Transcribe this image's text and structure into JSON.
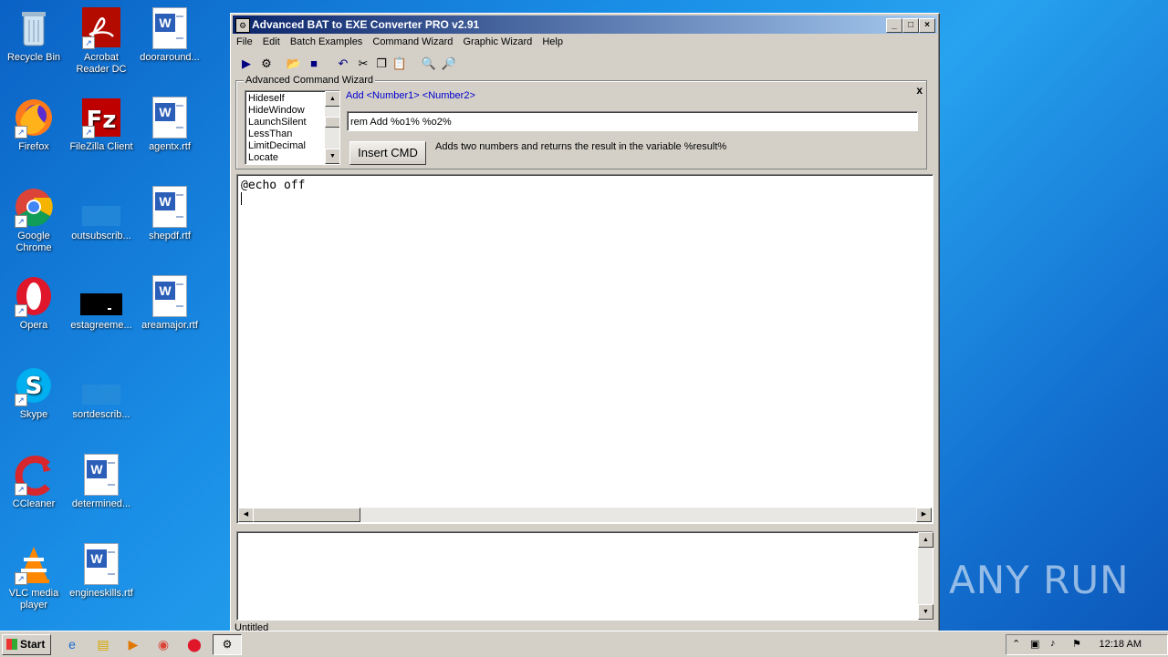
{
  "desktop": {
    "icons": [
      {
        "label": "Recycle Bin"
      },
      {
        "label": "Acrobat Reader DC"
      },
      {
        "label": "dooraround..."
      },
      {
        "label": "Firefox"
      },
      {
        "label": "FileZilla Client"
      },
      {
        "label": "agentx.rtf"
      },
      {
        "label": "Google Chrome"
      },
      {
        "label": "outsubscrib..."
      },
      {
        "label": "shepdf.rtf"
      },
      {
        "label": "Opera"
      },
      {
        "label": "estagreeme..."
      },
      {
        "label": "areamajor.rtf"
      },
      {
        "label": "Skype"
      },
      {
        "label": "sortdescrib..."
      },
      {
        "label": "CCleaner"
      },
      {
        "label": "determined..."
      },
      {
        "label": "VLC media player"
      },
      {
        "label": "engineskills.rtf"
      }
    ],
    "watermark": "ANY RUN"
  },
  "window": {
    "title": "Advanced BAT to EXE Converter PRO v2.91",
    "menu": [
      "File",
      "Edit",
      "Batch Examples",
      "Command Wizard",
      "Graphic Wizard",
      "Help"
    ],
    "wizard": {
      "legend": "Advanced Command Wizard",
      "close": "x",
      "commands": [
        "Hideself",
        "HideWindow",
        "LaunchSilent",
        "LessThan",
        "LimitDecimal",
        "Locate"
      ],
      "syntax": "Add  <Number1> <Number2>",
      "command_value": "rem Add %o1% %o2%",
      "insert_label": "Insert CMD",
      "description": "Adds two numbers and returns the result in the variable %result%"
    },
    "editor": {
      "code": "@echo off"
    },
    "status": "Untitled"
  },
  "taskbar": {
    "start_label": "Start",
    "clock": "12:18 AM"
  }
}
